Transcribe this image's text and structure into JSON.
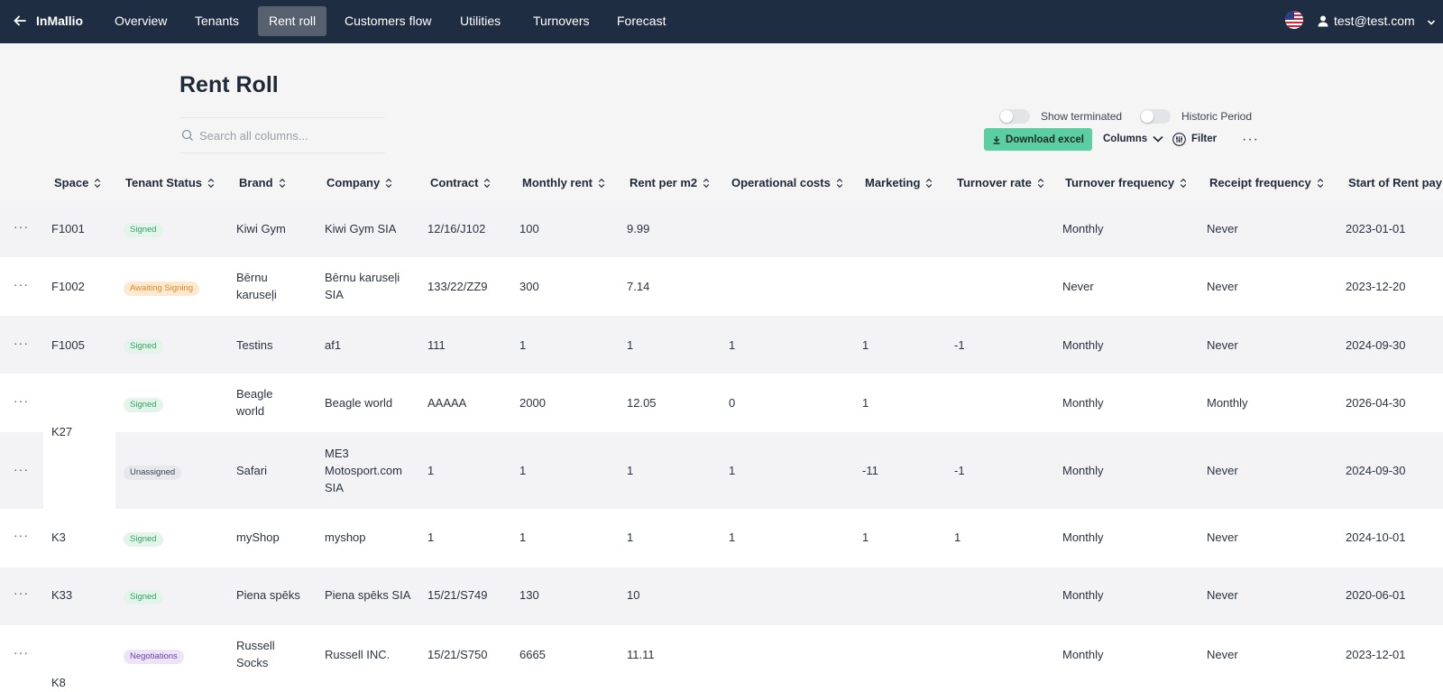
{
  "app": {
    "name": "InMallio"
  },
  "nav": {
    "items": [
      {
        "label": "Overview"
      },
      {
        "label": "Tenants"
      },
      {
        "label": "Rent roll",
        "active": true
      },
      {
        "label": "Customers flow"
      },
      {
        "label": "Utilities"
      },
      {
        "label": "Turnovers"
      },
      {
        "label": "Forecast"
      }
    ],
    "user_email": "test@test.com",
    "language_flag": "us-flag-icon"
  },
  "page": {
    "title": "Rent Roll",
    "search_placeholder": "Search all columns..."
  },
  "toolbar": {
    "show_terminated": "Show terminated",
    "historic_period": "Historic Period",
    "download_excel": "Download excel",
    "columns": "Columns",
    "filter": "Filter"
  },
  "colors": {
    "nav_bg": "#1f2d42",
    "nav_active": "#56606e",
    "excel_button": "#5bcfa1",
    "signed": "#37a264",
    "awaiting": "#e08a2a",
    "negotiations": "#6b3fb0"
  },
  "table": {
    "columns": [
      "Space",
      "Tenant Status",
      "Brand",
      "Company",
      "Contract",
      "Monthly rent",
      "Rent per m2",
      "Operational costs",
      "Marketing",
      "Turnover rate",
      "Turnover frequency",
      "Receipt frequency",
      "Start of Rent pay"
    ],
    "rows": [
      {
        "space": "F1001",
        "status": "Signed",
        "brand": [
          "Kiwi Gym"
        ],
        "company": [
          "Kiwi Gym SIA"
        ],
        "contract": "12/16/J102",
        "monthly_rent": "100",
        "rent_per_m2": "9.99",
        "op_costs": "",
        "marketing": "",
        "turnover_rate": "",
        "turnover_freq": "Monthly",
        "receipt_freq": "Never",
        "start": "2023-01-01"
      },
      {
        "space": "F1002",
        "status": "Awaiting Signing",
        "brand": [
          "Bērnu",
          "karuseļi"
        ],
        "company": [
          "Bērnu karuseļi",
          "SIA"
        ],
        "contract": "133/22/ZZ9",
        "monthly_rent": "300",
        "rent_per_m2": "7.14",
        "op_costs": "",
        "marketing": "",
        "turnover_rate": "",
        "turnover_freq": "Never",
        "receipt_freq": "Never",
        "start": "2023-12-20"
      },
      {
        "space": "F1005",
        "status": "Signed",
        "brand": [
          "Testins"
        ],
        "company": [
          "af1"
        ],
        "contract": "111",
        "monthly_rent": "1",
        "rent_per_m2": "1",
        "op_costs": "1",
        "marketing": "1",
        "turnover_rate": "-1",
        "turnover_freq": "Monthly",
        "receipt_freq": "Never",
        "start": "2024-09-30"
      },
      {
        "space": "",
        "status": "Signed",
        "brand": [
          "Beagle",
          "world"
        ],
        "company": [
          "Beagle world"
        ],
        "contract": "AAAAA",
        "monthly_rent": "2000",
        "rent_per_m2": "12.05",
        "op_costs": "0",
        "marketing": "1",
        "turnover_rate": "",
        "turnover_freq": "Monthly",
        "receipt_freq": "Monthly",
        "start": "2026-04-30"
      },
      {
        "space": "",
        "status": "Unassigned",
        "brand": [
          "Safari"
        ],
        "company": [
          "ME3",
          "Motosport.com",
          "SIA"
        ],
        "contract": "1",
        "monthly_rent": "1",
        "rent_per_m2": "1",
        "op_costs": "1",
        "marketing": "-11",
        "turnover_rate": "-1",
        "turnover_freq": "Monthly",
        "receipt_freq": "Never",
        "start": "2024-09-30"
      },
      {
        "space": "K3",
        "status": "Signed",
        "brand": [
          "myShop"
        ],
        "company": [
          "myshop"
        ],
        "contract": "1",
        "monthly_rent": "1",
        "rent_per_m2": "1",
        "op_costs": "1",
        "marketing": "1",
        "turnover_rate": "1",
        "turnover_freq": "Monthly",
        "receipt_freq": "Never",
        "start": "2024-10-01"
      },
      {
        "space": "K33",
        "status": "Signed",
        "brand": [
          "Piena spēks"
        ],
        "company": [
          "Piena spēks SIA"
        ],
        "contract": "15/21/S749",
        "monthly_rent": "130",
        "rent_per_m2": "10",
        "op_costs": "",
        "marketing": "",
        "turnover_rate": "",
        "turnover_freq": "Monthly",
        "receipt_freq": "Never",
        "start": "2020-06-01"
      },
      {
        "space": "",
        "status": "Negotiations",
        "brand": [
          "Russell",
          "Socks"
        ],
        "company": [
          "Russell INC."
        ],
        "contract": "15/21/S750",
        "monthly_rent": "6665",
        "rent_per_m2": "11.11",
        "op_costs": "",
        "marketing": "",
        "turnover_rate": "",
        "turnover_freq": "Monthly",
        "receipt_freq": "Never",
        "start": "2023-12-01"
      }
    ],
    "group_spaces": {
      "k27": "K27",
      "k8": "K8"
    }
  }
}
